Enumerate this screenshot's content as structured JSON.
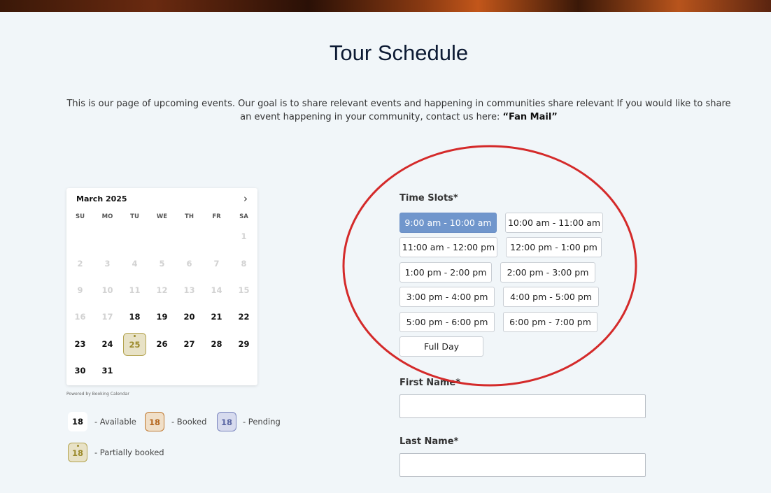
{
  "page": {
    "title": "Tour Schedule",
    "intro_text": "This is our page of upcoming events. Our goal is to share relevant events and happening in communities share relevant If you would like to share an event happening in your community, contact us here: ",
    "intro_link": "“Fan Mail”"
  },
  "calendar": {
    "month_label": "March 2025",
    "next_icon": "chevron-right-icon",
    "weekdays": [
      "SU",
      "MO",
      "TU",
      "WE",
      "TH",
      "FR",
      "SA"
    ],
    "days": [
      "1",
      "2",
      "3",
      "4",
      "5",
      "6",
      "7",
      "8",
      "9",
      "10",
      "11",
      "12",
      "13",
      "14",
      "15",
      "16",
      "17",
      "18",
      "19",
      "20",
      "21",
      "22",
      "23",
      "24",
      "25",
      "26",
      "27",
      "28",
      "29",
      "30",
      "31"
    ],
    "partially_booked_day": "25",
    "powered_by": "Powered by Booking Calendar"
  },
  "legend": {
    "sample_day": "18",
    "available": "- Available",
    "booked": "- Booked",
    "pending": "- Pending",
    "partial": "- Partially booked"
  },
  "form": {
    "time_slots_label": "Time Slots*",
    "slots": [
      "9:00 am - 10:00 am",
      "10:00 am - 11:00 am",
      "11:00 am - 12:00 pm",
      "12:00 pm - 1:00 pm",
      "1:00 pm - 2:00 pm",
      "2:00 pm - 3:00 pm",
      "3:00 pm - 4:00 pm",
      "4:00 pm - 5:00 pm",
      "5:00 pm - 6:00 pm",
      "6:00 pm - 7:00 pm",
      "Full Day"
    ],
    "selected_slot": "9:00 am - 10:00 am",
    "first_name_label": "First Name*",
    "first_name_value": "",
    "last_name_label": "Last Name*",
    "last_name_value": ""
  },
  "colors": {
    "background": "#f1f6f9",
    "selected_slot": "#7096cc",
    "annotation_circle": "#d42a2a",
    "booked": "#c07a33",
    "pending": "#7b86bf",
    "partial": "#b3a34f"
  }
}
